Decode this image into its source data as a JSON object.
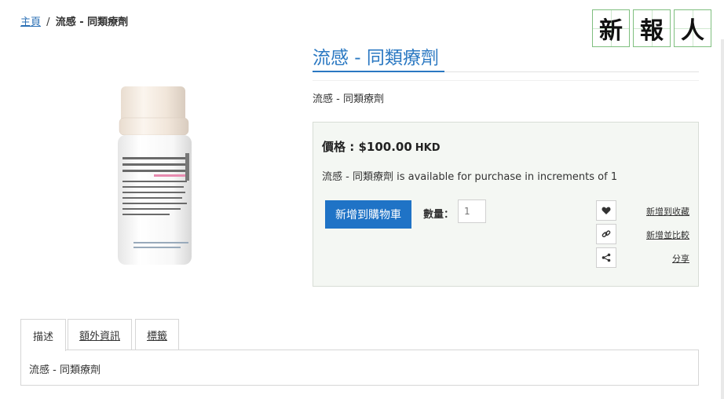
{
  "breadcrumb": {
    "home": "主頁",
    "separator": "/",
    "current": "流感 - 同類療劑"
  },
  "logo": {
    "chars": [
      "新",
      "報",
      "人"
    ]
  },
  "product": {
    "title": "流感 - 同類療劑",
    "short_description": "流感 - 同類療劑",
    "price_label": "價格 : $100.00",
    "currency": "HKD",
    "availability": "流感 - 同類療劑 is available for purchase in increments of 1"
  },
  "purchase": {
    "add_to_cart_label": "新增到購物車",
    "quantity_label": "數量：",
    "quantity_placeholder": "1"
  },
  "actions": {
    "wishlist_label": "新增到收藏",
    "compare_label": "新增並比較",
    "share_label": "分享"
  },
  "tabs": {
    "items": [
      {
        "label": "描述"
      },
      {
        "label": "額外資訊"
      },
      {
        "label": "標籤"
      }
    ],
    "active_content": "流感 - 同類療劑"
  },
  "colors": {
    "accent": "#2a78c2",
    "button": "#1f73c6",
    "price_box_bg": "#f4f7f3"
  }
}
